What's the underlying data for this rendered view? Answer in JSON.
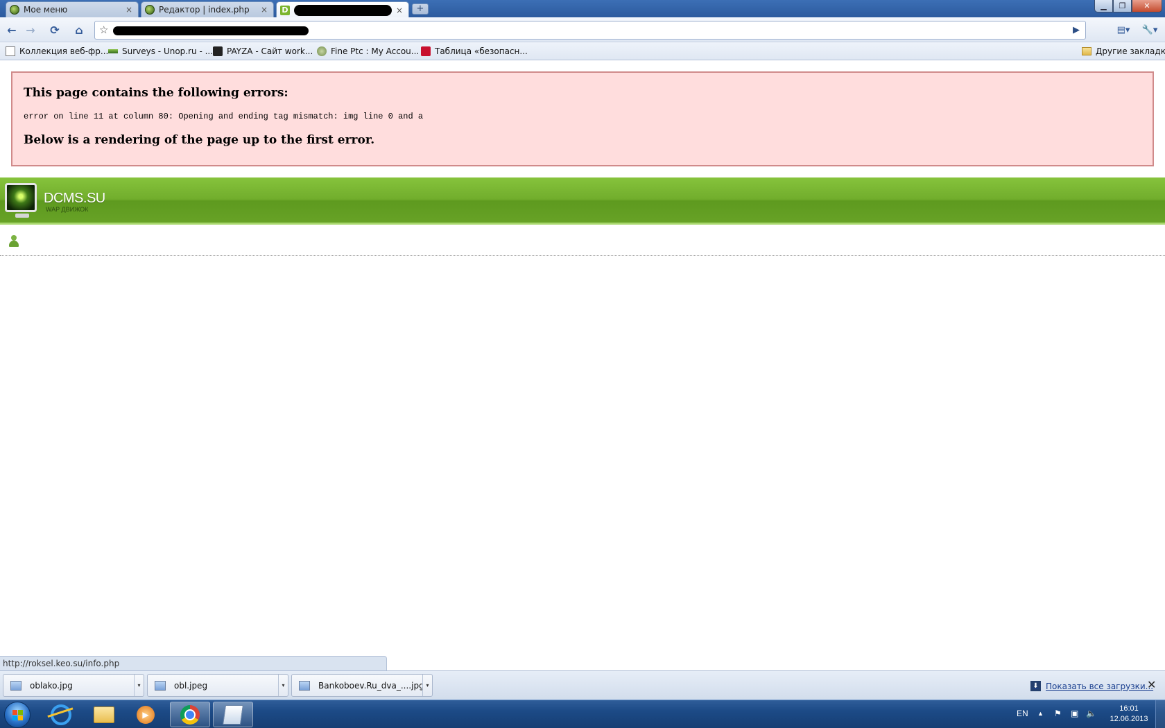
{
  "browser": {
    "tabs": [
      {
        "label": "Мое меню",
        "close": "×"
      },
      {
        "label": "Редактор | index.php",
        "close": "×"
      },
      {
        "label": "",
        "favicon_letter": "D",
        "close": "×"
      }
    ],
    "new_tab": "+",
    "window_buttons": {
      "minimize": "▁",
      "maximize": "❐",
      "close": "✕"
    }
  },
  "toolbar": {
    "back": "←",
    "forward": "→",
    "reload": "⟳",
    "home": "⌂",
    "star": "☆",
    "go": "▶",
    "page_menu": "▤▾",
    "wrench_menu": "🔧▾"
  },
  "bookmarks": [
    {
      "label": "Коллекция веб-фр...",
      "icon": "page-icon"
    },
    {
      "label": "Surveys - Unop.ru - ...",
      "icon": "surveys-icon"
    },
    {
      "label": "PAYZA - Сайт work...",
      "icon": "payza-icon"
    },
    {
      "label": "Fine Ptc : My Accou...",
      "icon": "fineptc-icon"
    },
    {
      "label": "Таблица «безопасн...",
      "icon": "table-icon"
    }
  ],
  "other_bookmarks": "Другие закладки",
  "page": {
    "error_heading": "This page contains the following errors:",
    "error_detail": "error on line 11 at column 80: Opening and ending tag mismatch: img line 0 and a",
    "error_footer": "Below is a rendering of the page up to the first error.",
    "site_title": "DCMS.SU",
    "site_subtitle": "WAP движок"
  },
  "status_url": "http://roksel.keo.su/info.php",
  "downloads": {
    "items": [
      {
        "name": "oblako.jpg"
      },
      {
        "name": "obl.jpeg"
      },
      {
        "name": "Bankoboev.Ru_dva_....jpg"
      }
    ],
    "caret": "▾",
    "show_all": "Показать все загрузки...",
    "close": "✕"
  },
  "taskbar": {
    "language": "EN",
    "tray_arrow": "▲",
    "time": "16:01",
    "date": "12.06.2013"
  }
}
